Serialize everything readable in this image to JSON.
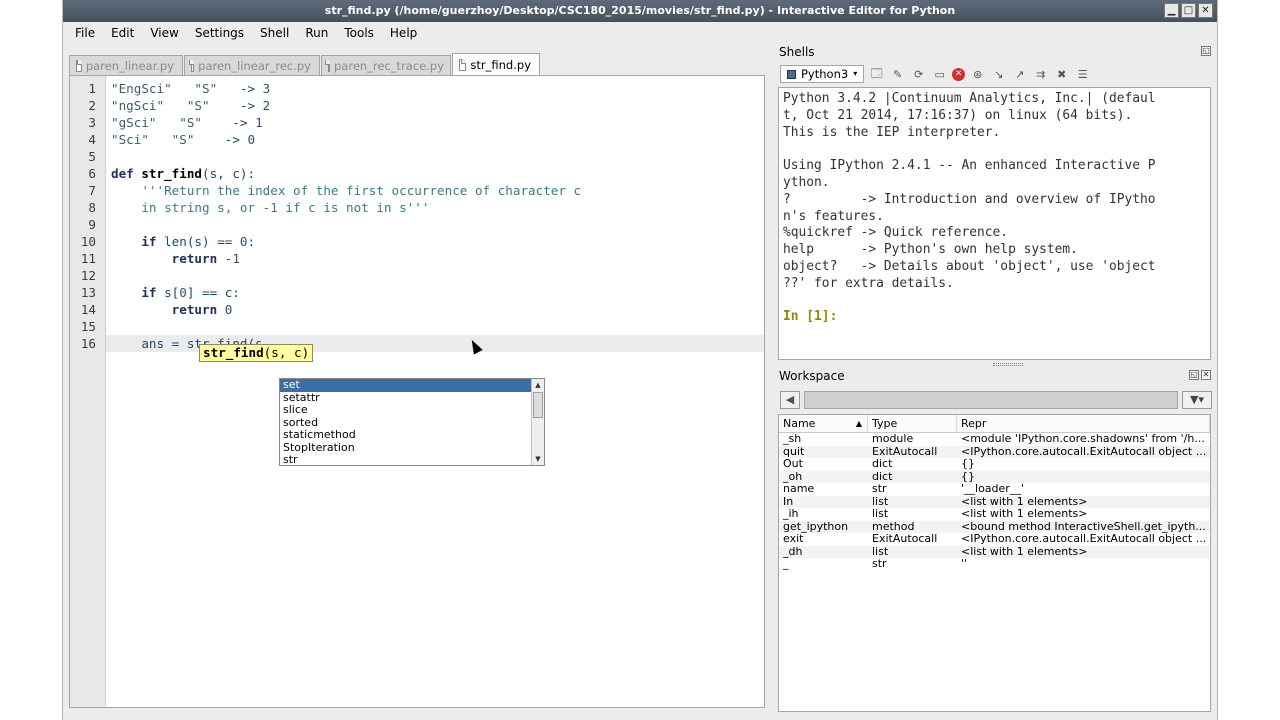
{
  "window": {
    "title": "str_find.py (/home/guerzhoy/Desktop/CSC180_2015/movies/str_find.py) - Interactive Editor for Python",
    "min_label": "▁",
    "max_label": "□",
    "close_label": "✕"
  },
  "menu": [
    "File",
    "Edit",
    "View",
    "Settings",
    "Shell",
    "Run",
    "Tools",
    "Help"
  ],
  "editor": {
    "tabs": [
      {
        "label": "paren_linear.py",
        "active": false
      },
      {
        "label": "paren_linear_rec.py",
        "active": false
      },
      {
        "label": "paren_rec_trace.py",
        "active": false
      },
      {
        "label": "str_find.py",
        "active": true
      }
    ],
    "lines": [
      {
        "n": "1",
        "html": "<span class='str'>\"EngSci\"</span>   <span class='str'>\"S\"</span>   -> <span class='num'>3</span>"
      },
      {
        "n": "2",
        "html": "<span class='str'>\"ngSci\"</span>   <span class='str'>\"S\"</span>    -> <span class='num'>2</span>"
      },
      {
        "n": "3",
        "html": "<span class='str'>\"gSci\"</span>   <span class='str'>\"S\"</span>    -> <span class='num'>1</span>"
      },
      {
        "n": "4",
        "html": "<span class='str'>\"Sci\"</span>   <span class='str'>\"S\"</span>    -> <span class='num'>0</span>"
      },
      {
        "n": "5",
        "html": ""
      },
      {
        "n": "6",
        "html": "<span class='kw'>def</span> <span class='fn'>str_find</span>(s, c):"
      },
      {
        "n": "7",
        "html": "    <span class='doc'>'''Return the index of the first occurrence of character c</span>"
      },
      {
        "n": "8",
        "html": "<span class='doc'>    in string s, or -1 if c is not in s'''</span>"
      },
      {
        "n": "9",
        "html": ""
      },
      {
        "n": "10",
        "html": "    <span class='kw'>if</span> len(s) == <span class='num'>0</span>:"
      },
      {
        "n": "11",
        "html": "        <span class='kw'>return</span> <span class='num'>-1</span>"
      },
      {
        "n": "12",
        "html": ""
      },
      {
        "n": "13",
        "html": "    <span class='kw'>if</span> s[<span class='num'>0</span>] == c:"
      },
      {
        "n": "14",
        "html": "        <span class='kw'>return</span> <span class='num'>0</span>"
      },
      {
        "n": "15",
        "html": ""
      },
      {
        "n": "16",
        "html": "    ans = str_find(s",
        "current": true
      }
    ],
    "calltip_name": "str_find",
    "calltip_args": "(s, c)",
    "autocomplete": [
      "set",
      "setattr",
      "slice",
      "sorted",
      "staticmethod",
      "StopIteration",
      "str"
    ],
    "autocomplete_selected": 0
  },
  "shells": {
    "title": "Shells",
    "tab_label": "Python3",
    "output": [
      "Python 3.4.2 |Continuum Analytics, Inc.| (defaul",
      "t, Oct 21 2014, 17:16:37) on linux (64 bits).",
      "This is the IEP interpreter.",
      "",
      "Using IPython 2.4.1 -- An enhanced Interactive P",
      "ython.",
      "?         -> Introduction and overview of IPytho",
      "n's features.",
      "%quickref -> Quick reference.",
      "help      -> Python's own help system.",
      "object?   -> Details about 'object', use 'object",
      "??' for extra details.",
      ""
    ],
    "prompt": "In [1]:"
  },
  "workspace": {
    "title": "Workspace",
    "columns": [
      "Name",
      "Type",
      "Repr"
    ],
    "rows": [
      [
        "_sh",
        "module",
        "<module 'IPython.core.shadowns' from '/h..."
      ],
      [
        "quit",
        "ExitAutocall",
        "<IPython.core.autocall.ExitAutocall object ..."
      ],
      [
        "Out",
        "dict",
        "{}"
      ],
      [
        "_oh",
        "dict",
        "{}"
      ],
      [
        "name",
        "str",
        "'__loader__'"
      ],
      [
        "In",
        "list",
        "<list with 1 elements>"
      ],
      [
        "_ih",
        "list",
        "<list with 1 elements>"
      ],
      [
        "get_ipython",
        "method",
        "<bound method InteractiveShell.get_ipyth..."
      ],
      [
        "exit",
        "ExitAutocall",
        "<IPython.core.autocall.ExitAutocall object ..."
      ],
      [
        "_dh",
        "list",
        "<list with 1 elements>"
      ],
      [
        "_",
        "str",
        "''"
      ]
    ]
  }
}
